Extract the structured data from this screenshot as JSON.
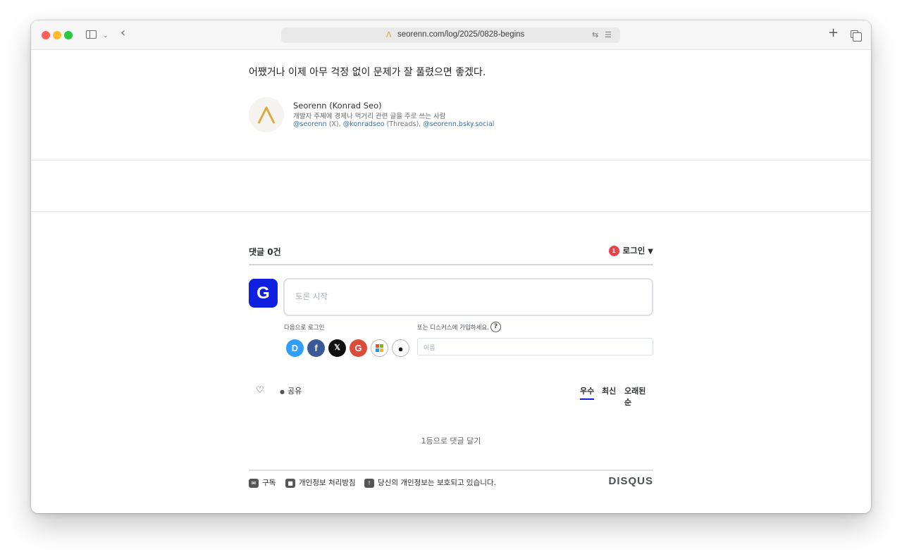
{
  "browser": {
    "url": "seorenn.com/log/2025/0828-begins"
  },
  "post": {
    "last_line": "어쨌거나 이제 아무 걱정 없이 문제가 잘 풀렸으면 좋겠다."
  },
  "author": {
    "name": "Seorenn (Konrad Seo)",
    "bio": "개발자 주제에 경제나 먹거리 관련 글을 주로 쓰는 사람",
    "link_x": "@seorenn",
    "label_x": " (X), ",
    "link_threads": "@konradseo",
    "label_threads": " (Threads), ",
    "link_bsky": "@seorenn.bsky.social"
  },
  "disqus": {
    "comment_count": "댓글 0건",
    "notification_count": "1",
    "login_label": "로그인",
    "avatar_letter": "G",
    "comment_placeholder": "토론 시작",
    "login_with": "다음으로 로그인",
    "signup_prompt": "또는 디스커스에 가입하세요.",
    "help": "?",
    "name_placeholder": "이름",
    "share": "공유",
    "sort": {
      "best": "우수",
      "newest": "최신",
      "oldest": "오래된 순"
    },
    "empty_message": "1등으로 댓글 달기",
    "footer": {
      "subscribe": "구독",
      "privacy": "개인정보 처리방침",
      "protected": "당신의 개인정보는 보호되고 있습니다."
    },
    "brand": "DISQUS"
  },
  "icons": {
    "x": "𝕏",
    "apple": "",
    "google": "G",
    "facebook": "f",
    "disqus": "D"
  },
  "colors": {
    "accent": "#1020e0",
    "notification": "#e8424b",
    "author_logo": "#e0a93d"
  }
}
